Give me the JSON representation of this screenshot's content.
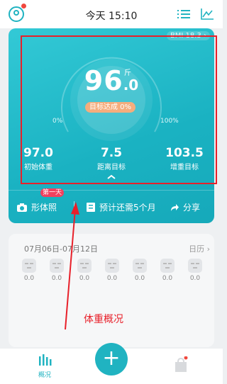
{
  "header": {
    "title": "今天 15:10",
    "icons": [
      "avatar",
      "list-icon",
      "chart-icon"
    ]
  },
  "card": {
    "bmi": "BMI 18.3 ›",
    "weight_int": "96",
    "weight_dec": ".0",
    "unit": "斤",
    "goal_badge": "目标达成 0%",
    "pct_start": "0%",
    "pct_end": "100%",
    "stats": [
      {
        "value": "97.0",
        "label": "初始体重"
      },
      {
        "value": "7.5",
        "label": "距离目标"
      },
      {
        "value": "103.5",
        "label": "增重目标"
      }
    ],
    "bottom": {
      "photo_label": "形体照",
      "first_day_tag": "第一天",
      "forecast": "预计还需5个月",
      "share": "分享"
    },
    "goal_progress": 0
  },
  "week": {
    "range": "07月06日-07月12日",
    "calendar": "日历 ›",
    "values": [
      "0.0",
      "0.0",
      "0.0",
      "0.0",
      "0.0",
      "0.0",
      "0.0"
    ]
  },
  "annotation": "体重概况",
  "tabs": {
    "overview": "概况",
    "add": "+"
  },
  "colors": {
    "accent": "#20b3c1",
    "badge": "#f5ad7d",
    "annotation": "#e8202a"
  }
}
